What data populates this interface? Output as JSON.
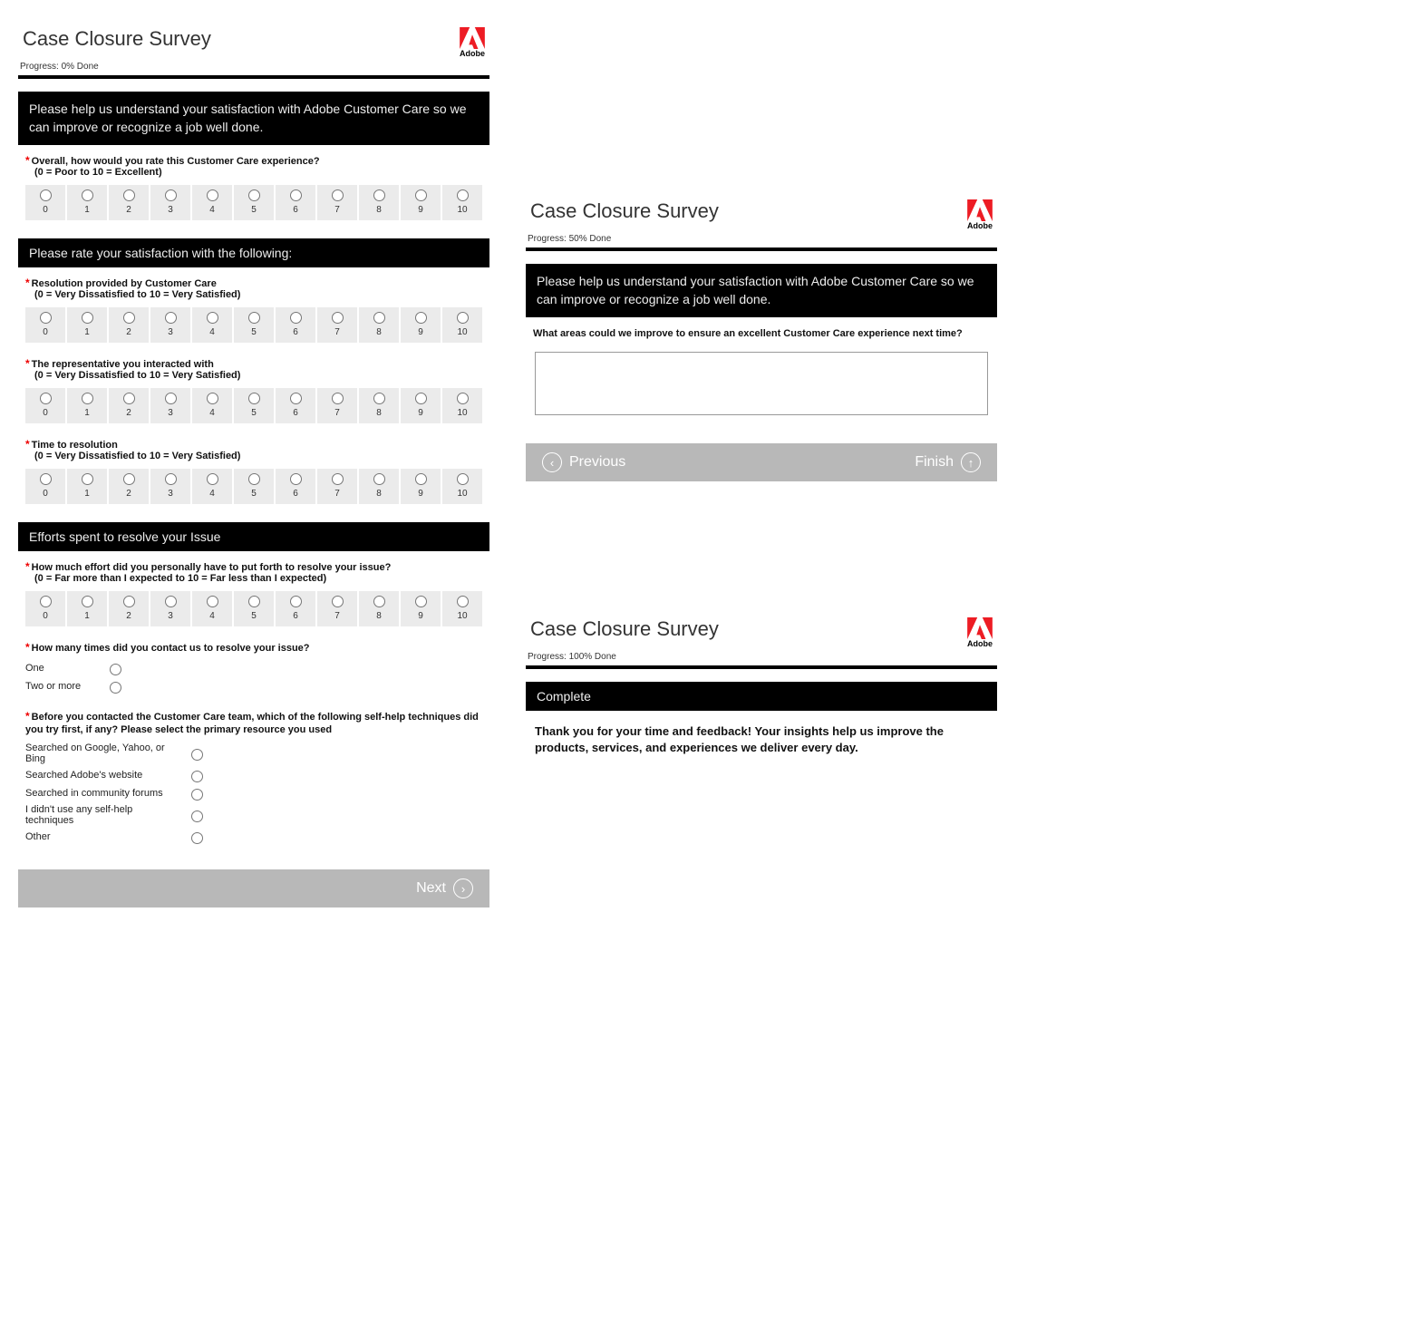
{
  "brand": {
    "name": "Adobe"
  },
  "survey_title": "Case Closure Survey",
  "page1": {
    "progress": "Progress: 0% Done",
    "intro": "Please help us understand your satisfaction with Adobe Customer Care so we can improve or recognize a job well done.",
    "q_overall": "Overall, how would you rate this Customer Care experience?",
    "q_overall_sub": "(0 = Poor to 10 = Excellent)",
    "sect_rate": "Please rate your satisfaction with the following:",
    "q_res": "Resolution provided by Customer Care",
    "q_res_sub": "(0 = Very Dissatisfied to 10 = Very Satisfied)",
    "q_rep": "The representative you interacted with",
    "q_rep_sub": "(0 = Very Dissatisfied to 10 = Very Satisfied)",
    "q_time": "Time to resolution",
    "q_time_sub": "(0 = Very Dissatisfied to 10 = Very Satisfied)",
    "sect_effort": "Efforts spent to resolve your Issue",
    "q_effort": "How much effort did you personally have to put forth to resolve your issue?",
    "q_effort_sub": "(0 = Far more than I expected to 10 = Far less than I expected)",
    "q_times": "How many times did you contact us to resolve your issue?",
    "opt_one": "One",
    "opt_two": "Two or more",
    "q_selfhelp": "Before you contacted the Customer Care team, which of the following self-help techniques did you try first, if any? Please select the primary resource you used",
    "opt_s1": "Searched on Google, Yahoo, or Bing",
    "opt_s2": "Searched Adobe's website",
    "opt_s3": "Searched in community forums",
    "opt_s4": "I didn't use any self-help techniques",
    "opt_s5": "Other",
    "next": "Next"
  },
  "page2": {
    "progress": "Progress: 50% Done",
    "intro": "Please help us understand your satisfaction with Adobe Customer Care so we can improve or recognize a job well done.",
    "q_improve": "What areas could we improve to ensure an excellent Customer Care experience next time?",
    "prev": "Previous",
    "finish": "Finish"
  },
  "page3": {
    "progress": "Progress: 100% Done",
    "sect_complete": "Complete",
    "thank": "Thank you for your time and feedback! Your insights help us improve the products, services, and experiences we deliver every day."
  },
  "scale": [
    "0",
    "1",
    "2",
    "3",
    "4",
    "5",
    "6",
    "7",
    "8",
    "9",
    "10"
  ]
}
